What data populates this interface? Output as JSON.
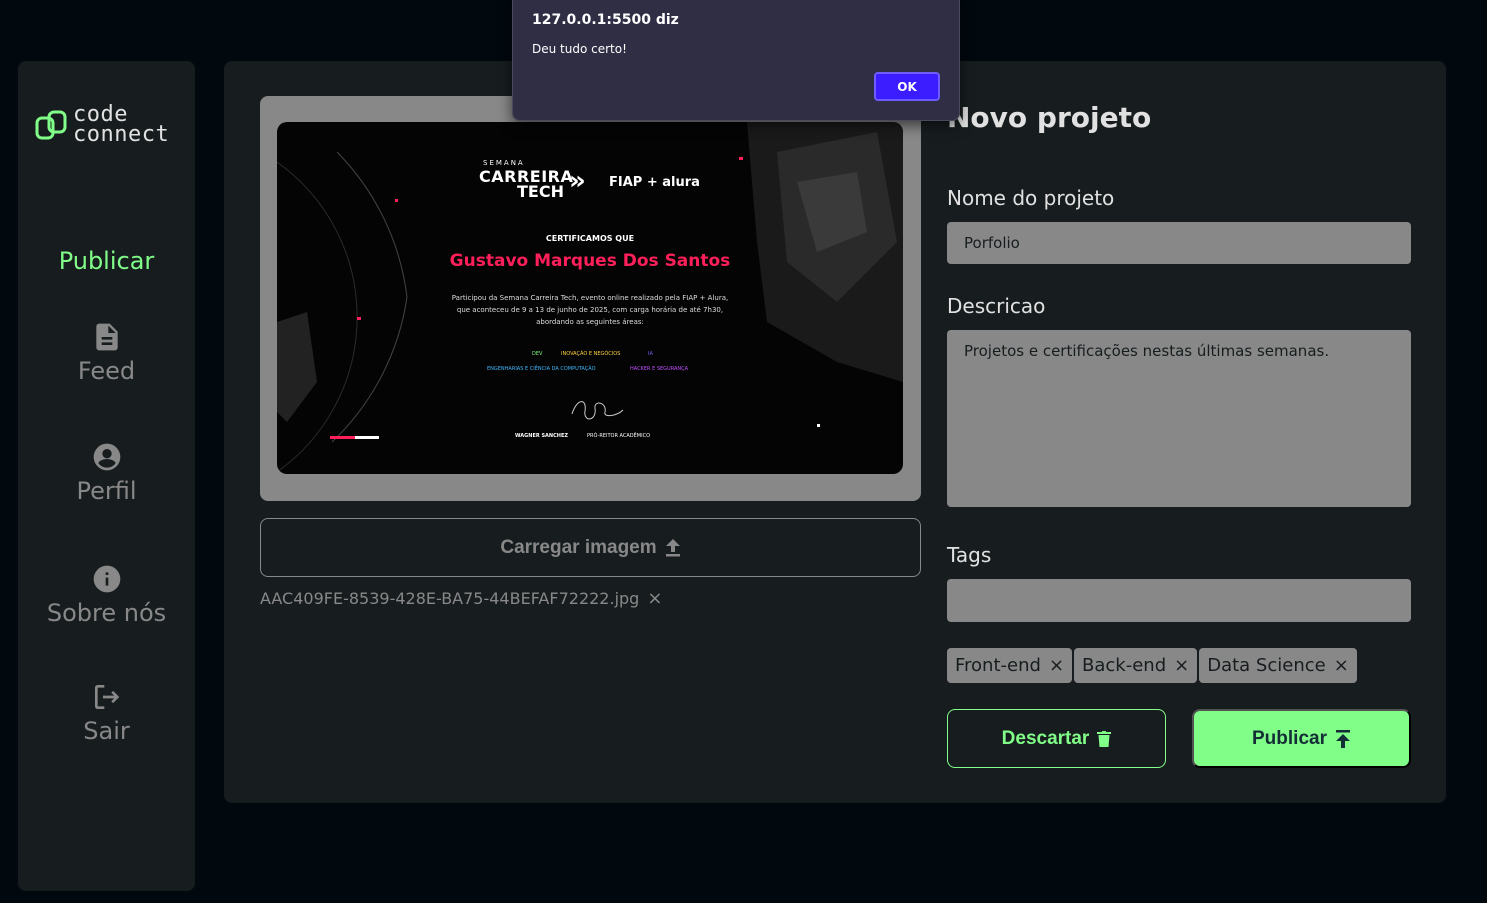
{
  "logo": {
    "line1": "code",
    "line2": "connect"
  },
  "sidebar": {
    "items": [
      {
        "label": "Publicar",
        "icon": "publish-icon"
      },
      {
        "label": "Feed",
        "icon": "document-icon"
      },
      {
        "label": "Perfil",
        "icon": "account-icon"
      },
      {
        "label": "Sobre nós",
        "icon": "info-icon"
      },
      {
        "label": "Sair",
        "icon": "logout-icon"
      }
    ]
  },
  "certificate": {
    "event_top": "SEMANA",
    "event_line1": "CARREIRA",
    "event_line2": "TECH",
    "partners": "FIAP + alura",
    "certify": "CERTIFICAMOS QUE",
    "name": "Gustavo Marques Dos Santos",
    "body1": "Participou da Semana Carreira Tech, evento online realizado pela FIAP + Alura,",
    "body2": "que aconteceu de 9 a 13 de junho de 2025, com carga horária de até 7h30,",
    "body3": "abordando as seguintes áreas:",
    "area1": "DEV",
    "area2": "INOVAÇÃO E NEGÓCIOS",
    "area3": "IA",
    "area4": "ENGENHARIAS E CIÊNCIA DA COMPUTAÇÃO",
    "area5": "HACKER E SEGURANÇA",
    "signer": "WAGNER SANCHEZ",
    "signer_role": "PRÓ-REITOR ACADÊMICO"
  },
  "upload": {
    "label": "Carregar imagem",
    "file_name": "AAC409FE-8539-428E-BA75-44BEFAF72222.jpg",
    "remove": "×"
  },
  "form": {
    "title": "Novo projeto",
    "name_label": "Nome do projeto",
    "name_value": "Porfolio",
    "desc_label": "Descricao",
    "desc_value": "Projetos e certificações nestas últimas semanas.",
    "tags_label": "Tags",
    "tags_value": "",
    "tags": [
      "Front-end",
      "Back-end",
      "Data Science"
    ],
    "tag_remove": "×",
    "discard_label": "Descartar",
    "publish_label": "Publicar"
  },
  "alert": {
    "title": "127.0.0.1:5500 diz",
    "message": "Deu tudo certo!",
    "ok_label": "OK"
  },
  "colors": {
    "background": "#01080e",
    "panel": "#171d1f",
    "accent": "#81fe88",
    "muted": "#888888",
    "alert_bg": "#2f2e45",
    "alert_button": "#3b1dff",
    "cert_name": "#ff1f5a"
  }
}
